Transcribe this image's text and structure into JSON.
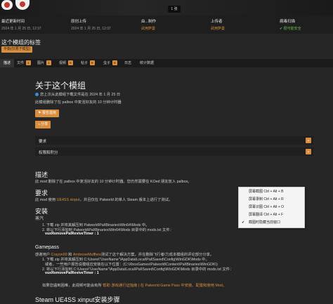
{
  "hero": {
    "image_count": "1 张"
  },
  "stats": [
    {
      "label": "最近更新时间",
      "value": "2024 年 1 月 25 日, 12:37",
      "style": "plain"
    },
    {
      "label": "原创上传",
      "value": "2024 年 1 月 25 日, 12:37",
      "style": "plain"
    },
    {
      "label": "由...制作",
      "value": "武用萨曼",
      "style": "link"
    },
    {
      "label": "上传者",
      "value": "武用萨曼",
      "style": "link"
    },
    {
      "label": "病毒扫描",
      "value": "✔ 很可能安全",
      "style": "safe"
    }
  ],
  "title": "这个模组的标签",
  "tag": "平衡(仅限于模型)",
  "tabs": [
    {
      "label": "描述",
      "badge": ""
    },
    {
      "label": "文件",
      "badge": "1"
    },
    {
      "label": "图片",
      "badge": "1"
    },
    {
      "label": "视频",
      "badge": "0"
    },
    {
      "label": "帖子",
      "badge": "8"
    },
    {
      "label": "虫子",
      "badge": "0"
    },
    {
      "label": "日志",
      "badge": ""
    },
    {
      "label": "统计数据",
      "badge": ""
    }
  ],
  "about": {
    "heading": "关于这个模组",
    "updated": "您上次从此模组下载文件是在 2024 年 1 月 25 日",
    "summary": "此模组删除了在 palbox 中复活好友的 10 分钟计时器",
    "report_button": "报告滥用",
    "share_button": "分享"
  },
  "accordions": [
    {
      "label": "要求"
    },
    {
      "label": "权限和积分"
    }
  ],
  "description": {
    "heading": "描述",
    "text": "此 mod 删除了在 palbox 中复活好友的 10 分钟计时器。您仍然需要在 KOed 朋友放入 palbox。"
  },
  "requirements": {
    "heading": "要求",
    "text_pre": "此 mod 使用 ",
    "link": "UE4SS xinput",
    "text_post": "，并且仅在 Palworld 的单人 Steam 版本上进行了测试。"
  },
  "install": {
    "heading": "安装",
    "steam_label": "蒸汽",
    "steam_1": "1. 下载 zip 并将其解压到 Palworld\\Pal\\Binaries\\Win64\\Mods 中。",
    "steam_2": "2. 将以下行添加到 Palworld\\Pal\\Binaries\\Win64\\Mods 目录中的 mods.txt 文件：",
    "steam_cmd": "vuxRemovePalReviveTimer : 1",
    "gamepass_label": "Gamepass",
    "thanks_pre": "感谢用户 ",
    "thanks_user1": "Crayon99",
    "thanks_mid": " 和 ",
    "thanks_user2": "AmbroseMufflers",
    "thanks_post": "测试了这个解决方案，并在删除飞行者/力成本模组的评论部分分享。",
    "gp_1": "1. 下载 zip 并将其解压到 C:\\Users\\\"UserName\"\\AppData\\Local\\Pal\\Saved\\Config\\WinGDK\\Mods 中。",
    "gp_1b": "或者，一些用户报告说模组应安装在以下位置：(C:\\XboxGames\\Palworld\\Content\\Pal\\Binaries\\WinGDK\\)",
    "gp_2": "2. 将以下行添加到 C:\\Users\\\"UserName\"\\AppData\\Local\\Pal\\Saved\\Config\\WinGDK\\Mods 目录中的 mods.txt 文件：",
    "gp_cmd": "vuxRemovePalReviveTimer : 1",
    "problem_pre": "如果您遇到困难，此视频可能会有所 ",
    "problem_link": "帮助 游戏通行证指南 | 在 Palworld Game Pass 中安装、配置和使用 Mod。"
  },
  "footer": {
    "heading": "Steam UE4SS xinput安装步骤"
  },
  "context_menu": [
    {
      "label": "屏幕截图 Ctrl + Alt + B",
      "checked": false
    },
    {
      "label": "屏幕录制 Ctrl + Alt + R",
      "checked": false
    },
    {
      "label": "屏幕识图 Ctrl + Alt + O",
      "checked": false
    },
    {
      "label": "屏幕翻译 Ctrl + Alt + F",
      "checked": false
    },
    {
      "label": "截图时隐藏当前窗口",
      "checked": true
    }
  ],
  "colors": {
    "accent": "#d98e3d",
    "background": "#262626",
    "safe": "#6fbf4a"
  }
}
